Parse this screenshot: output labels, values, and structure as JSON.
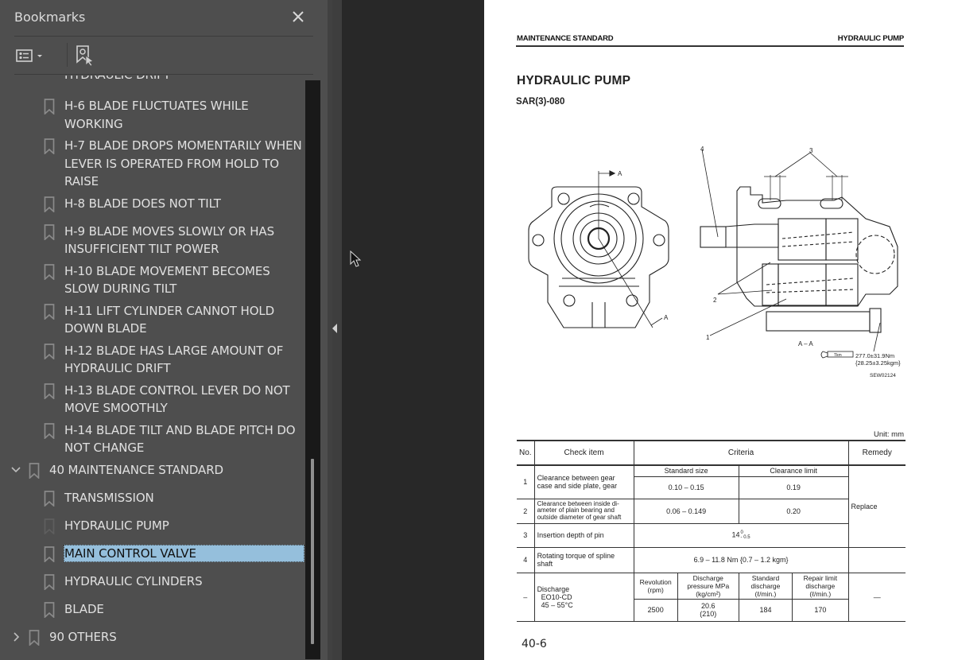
{
  "bookmarks_panel": {
    "title": "Bookmarks",
    "close_icon": "close-icon",
    "toolbar": {
      "options_icon": "list-options-icon",
      "options_dropdown_icon": "caret-down-icon",
      "expand_current_icon": "bookmark-find-current-icon"
    },
    "items": [
      {
        "label": "HYDRAULIC DRIFT",
        "level": 1,
        "icon": "bookmark-icon",
        "partial": true
      },
      {
        "label": "H-6 BLADE FLUCTUATES WHILE\nWORKING",
        "level": 1,
        "icon": "bookmark-icon"
      },
      {
        "label": "H-7 BLADE DROPS MOMENTARILY WHEN\nLEVER IS OPERATED FROM HOLD TO\nRAISE",
        "level": 1,
        "icon": "bookmark-icon"
      },
      {
        "label": "H-8 BLADE DOES NOT TILT",
        "level": 1,
        "icon": "bookmark-icon"
      },
      {
        "label": "H-9 BLADE MOVES SLOWLY OR HAS\nINSUFFICIENT TILT POWER",
        "level": 1,
        "icon": "bookmark-icon"
      },
      {
        "label": "H-10 BLADE MOVEMENT BECOMES\nSLOW DURING TILT",
        "level": 1,
        "icon": "bookmark-icon"
      },
      {
        "label": "H-11 LIFT CYLINDER CANNOT HOLD\nDOWN BLADE",
        "level": 1,
        "icon": "bookmark-icon"
      },
      {
        "label": "H-12 BLADE HAS LARGE AMOUNT OF\nHYDRAULIC DRIFT",
        "level": 1,
        "icon": "bookmark-icon"
      },
      {
        "label": "H-13 BLADE CONTROL LEVER DO NOT\nMOVE SMOOTHLY",
        "level": 1,
        "icon": "bookmark-icon"
      },
      {
        "label": "H-14 BLADE TILT AND BLADE PITCH DO\nNOT CHANGE",
        "level": 1,
        "icon": "bookmark-icon"
      },
      {
        "label": "40 MAINTENANCE STANDARD",
        "level": 0,
        "icon": "bookmark-icon",
        "expander": "chevron-down-icon",
        "expanded": true
      },
      {
        "label": "TRANSMISSION",
        "level": 1,
        "icon": "bookmark-icon"
      },
      {
        "label": "HYDRAULIC PUMP",
        "level": 1,
        "icon": "bookmark-icon",
        "dimmed_icon": true
      },
      {
        "label": "MAIN CONTROL VALVE",
        "level": 1,
        "icon": "bookmark-icon",
        "selected": true
      },
      {
        "label": "HYDRAULIC CYLINDERS",
        "level": 1,
        "icon": "bookmark-icon"
      },
      {
        "label": "BLADE",
        "level": 1,
        "icon": "bookmark-icon"
      },
      {
        "label": "90 OTHERS",
        "level": 0,
        "icon": "bookmark-icon",
        "expander": "chevron-right-icon",
        "expanded": false
      }
    ],
    "scroll_position_fraction": 0.65,
    "selected_color": "#95bfdc"
  },
  "splitter": {
    "collapse_icon": "triangle-left-icon"
  },
  "document": {
    "header_left": "MAINTENANCE STANDARD",
    "header_right": "HYDRAULIC PUMP",
    "title": "HYDRAULIC PUMP",
    "model": "SAR(3)-080",
    "diagram": {
      "section_marker": "A",
      "section_label": "A – A",
      "callouts": [
        "1",
        "2",
        "3",
        "4"
      ],
      "torque_line1": "277.0±31.9Nm",
      "torque_line2": "{28.25±3.25kgm}",
      "torque_icon_label": "Tkm",
      "drawing_id": "SEW02124"
    },
    "unit": "Unit: mm",
    "table": {
      "headers": {
        "no": "No.",
        "check_item": "Check item",
        "criteria": "Criteria",
        "remedy": "Remedy"
      },
      "subheaders": {
        "standard_size": "Standard size",
        "clearance_limit": "Clearance limit"
      },
      "rows": [
        {
          "no": "1",
          "item": "Clearance between gear case and side plate, gear",
          "standard": "0.10 – 0.15",
          "limit": "0.19"
        },
        {
          "no": "2",
          "item": "Clearance between inside di-ameter of plain bearing and outside diameter of gear shaft",
          "standard": "0.06 – 0.149",
          "limit": "0.20"
        },
        {
          "no": "3",
          "item": "Insertion depth of pin",
          "value": "14",
          "tol_upper": "0",
          "tol_lower": "- 0.5"
        },
        {
          "no": "4",
          "item": "Rotating torque of spline shaft",
          "value": "6.9 – 11.8 Nm {0.7 – 1.2 kgm}"
        }
      ],
      "remedy_rows_1_4": "Replace",
      "discharge": {
        "no": "–",
        "item_line1": "Discharge",
        "item_line2": "EO10-CD",
        "item_line3": "45 – 55°C",
        "col_headers": [
          "Revolution (rpm)",
          "Discharge pressure MPa (kg/cm²)",
          "Standard discharge (ℓ/min.)",
          "Repair limit discharge (ℓ/min.)"
        ],
        "values": [
          "2500",
          "20.6\n(210)",
          "184",
          "170"
        ],
        "remedy": "—"
      }
    },
    "page_number": "40-6"
  }
}
